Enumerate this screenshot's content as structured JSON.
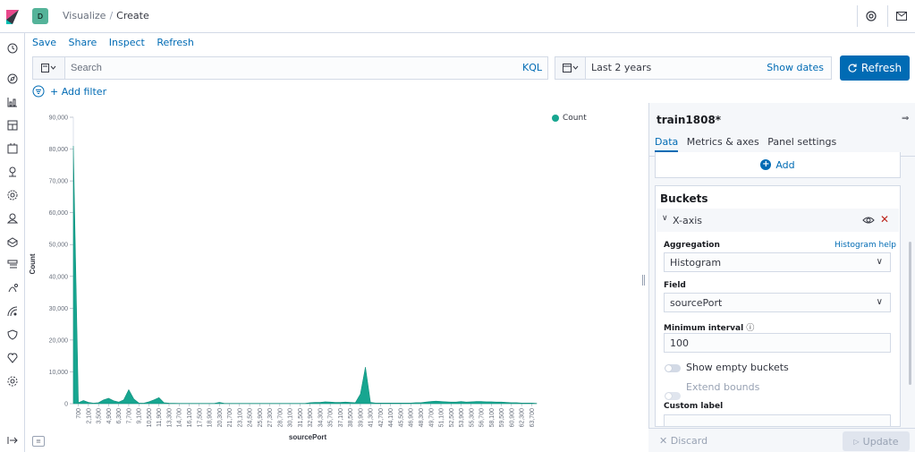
{
  "header": {
    "space_badge": "D",
    "breadcrumb_parent": "Visualize",
    "breadcrumb_current": "Create"
  },
  "top_menu": {
    "save": "Save",
    "share": "Share",
    "inspect": "Inspect",
    "refresh": "Refresh"
  },
  "query_bar": {
    "search_placeholder": "Search",
    "kql": "KQL",
    "date_range": "Last 2 years",
    "show_dates": "Show dates",
    "refresh_button": "Refresh"
  },
  "filter_bar": {
    "add_filter": "+ Add filter"
  },
  "colors": {
    "series": "#17a690",
    "accent": "#006bb4"
  },
  "chart_data": {
    "type": "area",
    "ylabel": "Count",
    "xlabel": "sourcePort",
    "ylim": [
      0,
      90000
    ],
    "y_ticks": [
      "0",
      "10,000",
      "20,000",
      "30,000",
      "40,000",
      "50,000",
      "60,000",
      "70,000",
      "80,000",
      "90,000"
    ],
    "x_tick_labels": [
      "700",
      "2,100",
      "3,500",
      "4,900",
      "6,300",
      "7,700",
      "9,100",
      "10,500",
      "11,900",
      "13,300",
      "14,700",
      "16,100",
      "17,500",
      "18,900",
      "20,300",
      "21,700",
      "23,100",
      "24,500",
      "25,900",
      "27,300",
      "28,700",
      "30,100",
      "31,500",
      "32,900",
      "34,300",
      "35,700",
      "37,100",
      "38,500",
      "39,900",
      "41,300",
      "42,700",
      "44,100",
      "45,500",
      "46,900",
      "48,300",
      "49,700",
      "51,100",
      "52,500",
      "53,900",
      "55,300",
      "56,700",
      "58,100",
      "59,500",
      "60,900",
      "62,300",
      "63,700"
    ],
    "legend": "top-right",
    "series": [
      {
        "name": "Count",
        "x": [
          0,
          700,
          1400,
          2100,
          2800,
          3500,
          4200,
          4900,
          5600,
          6300,
          7000,
          7700,
          8400,
          9100,
          9800,
          10500,
          11200,
          11900,
          12600,
          13300,
          14000,
          14700,
          15400,
          16100,
          16800,
          17500,
          18200,
          18900,
          19600,
          20300,
          21000,
          21700,
          22400,
          23100,
          23800,
          24500,
          25200,
          25900,
          26600,
          27300,
          28000,
          28700,
          29400,
          30100,
          30800,
          31500,
          32200,
          32900,
          33600,
          34300,
          35000,
          35700,
          36400,
          37100,
          37800,
          38500,
          39200,
          39900,
          40600,
          41300,
          42000,
          42700,
          43400,
          44100,
          44800,
          45500,
          46200,
          46900,
          47600,
          48300,
          49000,
          49700,
          50400,
          51100,
          51800,
          52500,
          53200,
          53900,
          54600,
          55300,
          56000,
          56700,
          57400,
          58100,
          58800,
          59500,
          60200,
          60900,
          61600,
          62300,
          63000,
          63700,
          64400
        ],
        "values": [
          81000,
          300,
          1000,
          400,
          150,
          300,
          1200,
          1700,
          900,
          500,
          1200,
          4400,
          1500,
          200,
          150,
          600,
          1200,
          1900,
          300,
          150,
          120,
          100,
          100,
          100,
          100,
          100,
          100,
          100,
          100,
          400,
          100,
          100,
          100,
          100,
          100,
          100,
          100,
          100,
          100,
          100,
          100,
          100,
          100,
          100,
          100,
          100,
          100,
          300,
          400,
          400,
          600,
          500,
          400,
          400,
          500,
          400,
          300,
          3000,
          11500,
          400,
          200,
          200,
          200,
          200,
          200,
          200,
          200,
          200,
          300,
          300,
          500,
          700,
          800,
          700,
          600,
          500,
          500,
          700,
          500,
          600,
          700,
          700,
          600,
          600,
          500,
          500,
          400,
          300,
          300,
          200,
          200,
          200,
          100
        ]
      }
    ]
  },
  "sidebar": {
    "title": "train1808*",
    "tabs": [
      "Data",
      "Metrics & axes",
      "Panel settings"
    ],
    "add": "Add",
    "buckets_title": "Buckets",
    "bucket_label": "X-axis",
    "aggregation_label": "Aggregation",
    "aggregation_help": "Histogram help",
    "aggregation_value": "Histogram",
    "field_label": "Field",
    "field_value": "sourcePort",
    "min_interval_label": "Minimum interval",
    "min_interval_value": "100",
    "show_empty_buckets": "Show empty buckets",
    "extend_bounds": "Extend bounds",
    "custom_label": "Custom label",
    "discard": "Discard",
    "update": "Update"
  }
}
